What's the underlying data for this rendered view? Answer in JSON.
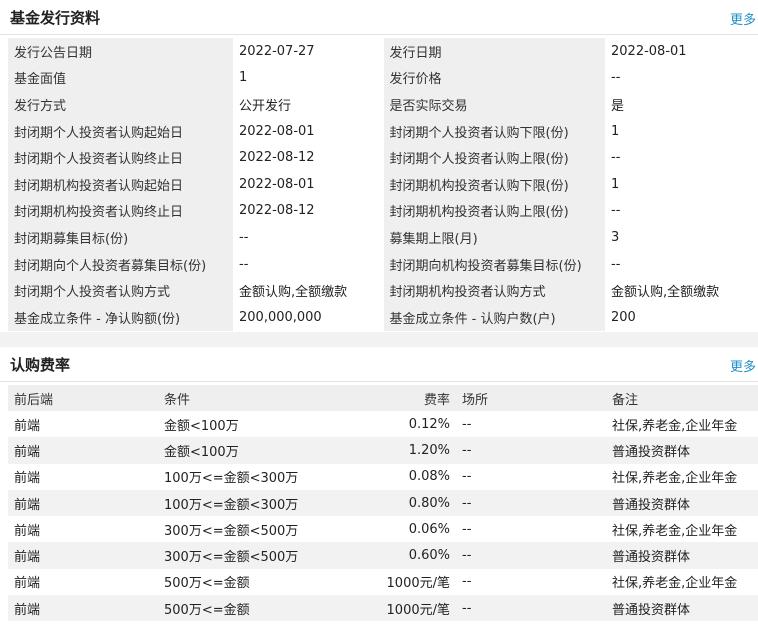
{
  "issuance": {
    "title": "基金发行资料",
    "more": "更多",
    "rows": [
      {
        "l1": "发行公告日期",
        "v1": "2022-07-27",
        "l2": "发行日期",
        "v2": "2022-08-01"
      },
      {
        "l1": "基金面值",
        "v1": "1",
        "l2": "发行价格",
        "v2": "--"
      },
      {
        "l1": "发行方式",
        "v1": "公开发行",
        "l2": "是否实际交易",
        "v2": "是"
      },
      {
        "l1": "封闭期个人投资者认购起始日",
        "v1": "2022-08-01",
        "l2": "封闭期个人投资者认购下限(份)",
        "v2": "1"
      },
      {
        "l1": "封闭期个人投资者认购终止日",
        "v1": "2022-08-12",
        "l2": "封闭期个人投资者认购上限(份)",
        "v2": "--"
      },
      {
        "l1": "封闭期机构投资者认购起始日",
        "v1": "2022-08-01",
        "l2": "封闭期机构投资者认购下限(份)",
        "v2": "1"
      },
      {
        "l1": "封闭期机构投资者认购终止日",
        "v1": "2022-08-12",
        "l2": "封闭期机构投资者认购上限(份)",
        "v2": "--"
      },
      {
        "l1": "封闭期募集目标(份)",
        "v1": "--",
        "l2": "募集期上限(月)",
        "v2": "3"
      },
      {
        "l1": "封闭期向个人投资者募集目标(份)",
        "v1": "--",
        "l2": "封闭期向机构投资者募集目标(份)",
        "v2": "--"
      },
      {
        "l1": "封闭期个人投资者认购方式",
        "v1": "金额认购,全额缴款",
        "l2": "封闭期机构投资者认购方式",
        "v2": "金额认购,全额缴款"
      },
      {
        "l1": "基金成立条件 - 净认购额(份)",
        "v1": "200,000,000",
        "l2": "基金成立条件 - 认购户数(户)",
        "v2": "200"
      }
    ]
  },
  "fees": {
    "title": "认购费率",
    "more": "更多",
    "headers": {
      "stage": "前后端",
      "condition": "条件",
      "rate": "费率",
      "venue": "场所",
      "note": "备注"
    },
    "rows": [
      {
        "stage": "前端",
        "condition": "金额<100万",
        "rate": "0.12%",
        "venue": "--",
        "note": "社保,养老金,企业年金"
      },
      {
        "stage": "前端",
        "condition": "金额<100万",
        "rate": "1.20%",
        "venue": "--",
        "note": "普通投资群体"
      },
      {
        "stage": "前端",
        "condition": "100万<=金额<300万",
        "rate": "0.08%",
        "venue": "--",
        "note": "社保,养老金,企业年金"
      },
      {
        "stage": "前端",
        "condition": "100万<=金额<300万",
        "rate": "0.80%",
        "venue": "--",
        "note": "普通投资群体"
      },
      {
        "stage": "前端",
        "condition": "300万<=金额<500万",
        "rate": "0.06%",
        "venue": "--",
        "note": "社保,养老金,企业年金"
      },
      {
        "stage": "前端",
        "condition": "300万<=金额<500万",
        "rate": "0.60%",
        "venue": "--",
        "note": "普通投资群体"
      },
      {
        "stage": "前端",
        "condition": "500万<=金额",
        "rate": "1000元/笔",
        "venue": "--",
        "note": "社保,养老金,企业年金"
      },
      {
        "stage": "前端",
        "condition": "500万<=金额",
        "rate": "1000元/笔",
        "venue": "--",
        "note": "普通投资群体"
      }
    ]
  }
}
